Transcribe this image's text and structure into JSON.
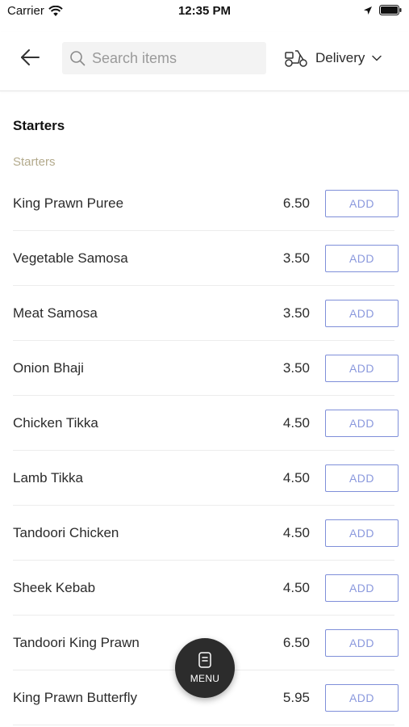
{
  "status_bar": {
    "carrier": "Carrier",
    "time": "12:35 PM"
  },
  "header": {
    "search_placeholder": "Search items",
    "delivery_label": "Delivery",
    "icons": {
      "back": "back-arrow-icon",
      "search": "search-icon",
      "delivery": "scooter-icon",
      "dropdown": "chevron-down-icon"
    }
  },
  "section_title": "Starters",
  "subcategory": "Starters",
  "items": [
    {
      "name": "King Prawn Puree",
      "price": "6.50",
      "button": "ADD"
    },
    {
      "name": "Vegetable Samosa",
      "price": "3.50",
      "button": "ADD"
    },
    {
      "name": "Meat Samosa",
      "price": "3.50",
      "button": "ADD"
    },
    {
      "name": "Onion Bhaji",
      "price": "3.50",
      "button": "ADD"
    },
    {
      "name": "Chicken Tikka",
      "price": "4.50",
      "button": "ADD"
    },
    {
      "name": "Lamb Tikka",
      "price": "4.50",
      "button": "ADD"
    },
    {
      "name": "Tandoori Chicken",
      "price": "4.50",
      "button": "ADD"
    },
    {
      "name": "Sheek Kebab",
      "price": "4.50",
      "button": "ADD"
    },
    {
      "name": "Tandoori King Prawn",
      "price": "6.50",
      "button": "ADD"
    },
    {
      "name": "King Prawn Butterfly",
      "price": "5.95",
      "button": "ADD"
    }
  ],
  "menu_fab": {
    "label": "MENU",
    "icon": "menu-card-icon"
  },
  "colors": {
    "accent": "#7f8fd9",
    "subcategory": "#b3aa8c",
    "fab": "#2c2c2c"
  }
}
